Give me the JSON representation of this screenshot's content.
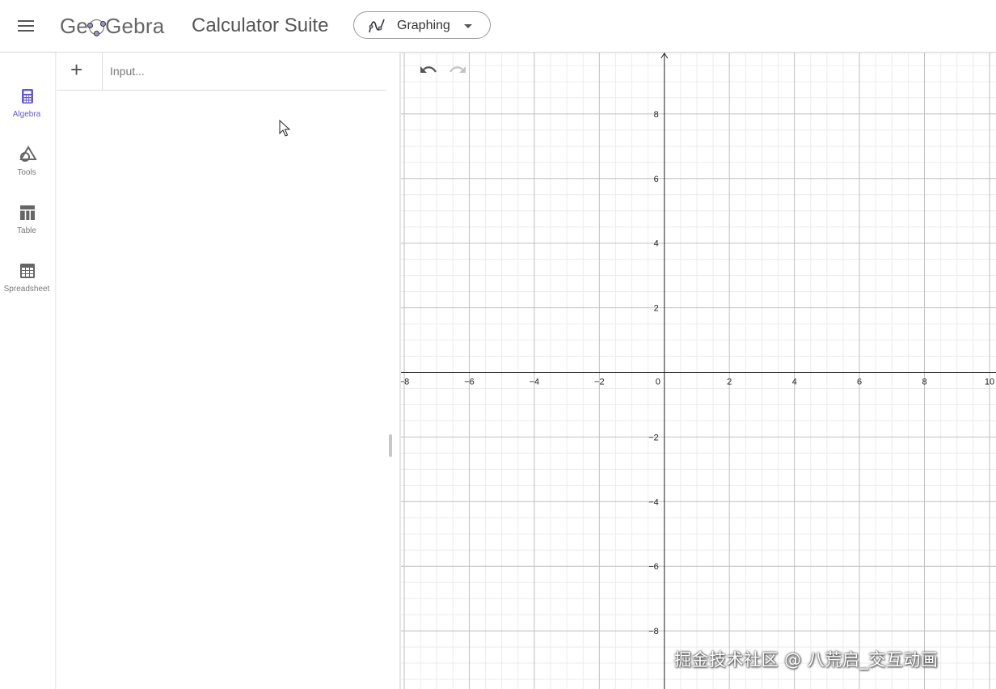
{
  "header": {
    "logo_pre": "Ge",
    "logo_post": "Gebra",
    "suite_title": "Calculator Suite",
    "app_switcher_label": "Graphing"
  },
  "sidebar": {
    "items": [
      {
        "label": "Algebra",
        "icon": "calculator-icon",
        "active": true
      },
      {
        "label": "Tools",
        "icon": "shapes-icon",
        "active": false
      },
      {
        "label": "Table",
        "icon": "table-icon",
        "active": false
      },
      {
        "label": "Spreadsheet",
        "icon": "spreadsheet-icon",
        "active": false
      }
    ]
  },
  "algebra": {
    "add_label": "+",
    "input_placeholder": "Input...",
    "input_value": ""
  },
  "graph": {
    "x_ticks": [
      "−8",
      "−6",
      "−4",
      "−2",
      "0",
      "2",
      "4",
      "6",
      "8",
      "10"
    ],
    "y_ticks": [
      "8",
      "6",
      "4",
      "2",
      "−2",
      "−4",
      "−6",
      "−8"
    ],
    "x_range": [
      -8.1,
      10.2
    ],
    "y_range": [
      -9.8,
      9.9
    ],
    "grid": true
  },
  "watermark": "掘金技术社区 @ 八荒启_交互动画",
  "colors": {
    "accent": "#6557d2",
    "axis": "#222222",
    "major_grid": "#c0c0c0",
    "minor_grid": "#ececec"
  }
}
